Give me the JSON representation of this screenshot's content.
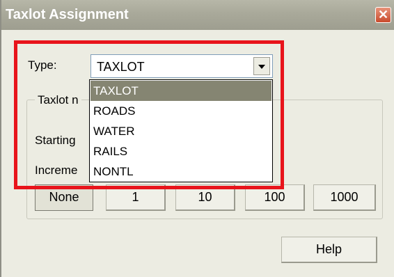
{
  "window": {
    "title": "Taxlot Assignment",
    "close_symbol": "✕"
  },
  "type_field": {
    "label": "Type:",
    "value": "TAXLOT",
    "options": [
      "TAXLOT",
      "ROADS",
      "WATER",
      "RAILS",
      "NONTL"
    ],
    "selected_index": 0
  },
  "group": {
    "label": "Taxlot n",
    "starting_label": "Starting",
    "increment_label": "Increme"
  },
  "increment_buttons": [
    "None",
    "1",
    "10",
    "100",
    "1000"
  ],
  "help_button": "Help",
  "colors": {
    "highlight": "#e8141b",
    "selected_item": "#858572"
  }
}
